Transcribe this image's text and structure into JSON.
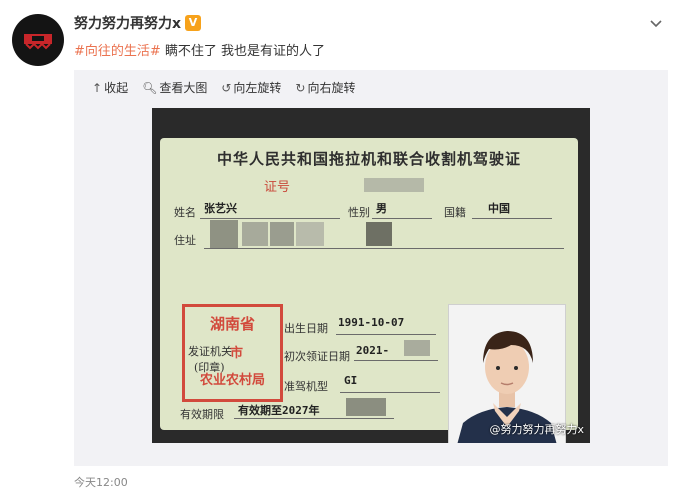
{
  "user": {
    "name": "努力努力再努力x",
    "verified_badge": "V",
    "avatar": "avatar"
  },
  "post": {
    "topic": "#向往的生活#",
    "text": " 瞒不住了 我也是有证的人了"
  },
  "toolbar": {
    "collapse": "收起",
    "view_large": "查看大图",
    "rotate_left": "向左旋转",
    "rotate_right": "向右旋转"
  },
  "license": {
    "title": "中华人民共和国拖拉机和联合收割机驾驶证",
    "cert_no_label": "证号",
    "name_label": "姓名",
    "name_value": "张艺兴",
    "sex_label": "性别",
    "sex_value": "男",
    "nationality_label": "国籍",
    "nationality_value": "中国",
    "address_label": "住址",
    "birth_label": "出生日期",
    "birth_value": "1991-10-07",
    "issue_label": "初次领证日期",
    "issue_value": "2021-",
    "type_label": "准驾机型",
    "type_value": "GI",
    "validity_label": "有效期限",
    "validity_value": "有效期至2027年",
    "issuer_label": "发证机关",
    "seal_label": "(印章)",
    "stamp_top": "湖南省",
    "stamp_mid": "市",
    "stamp_bottom": "农业农村局"
  },
  "image_watermark": "@努力努力再努力x",
  "timestamp": "今天12:00",
  "colors": {
    "topic": "#eb7350",
    "badge": "#f7a21b",
    "card_bg": "#f2f2f5"
  }
}
